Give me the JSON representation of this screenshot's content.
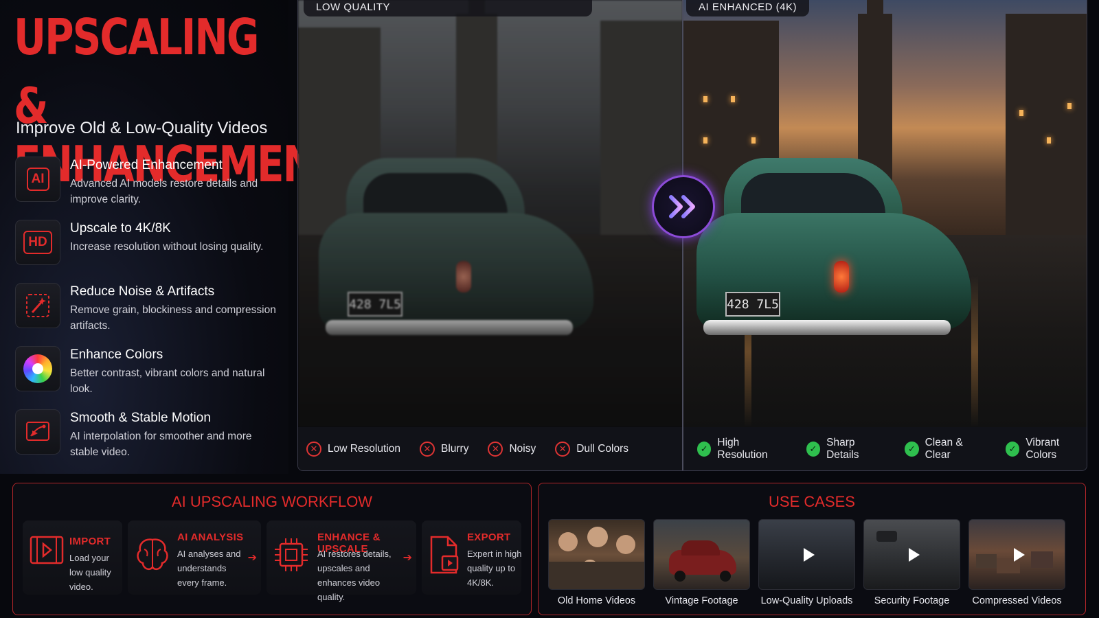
{
  "hero": {
    "title_line1": "UPSCALING &",
    "title_line2": "ENHANCEMENT",
    "subtitle": "Improve Old & Low-Quality Videos"
  },
  "features": [
    {
      "icon": "ai-chip-icon",
      "badge": "AI",
      "title": "AI-Powered Enhancement",
      "desc": "Advanced AI models restore details and improve clarity."
    },
    {
      "icon": "hd-icon",
      "badge": "HD",
      "title": "Upscale to 4K/8K",
      "desc": "Increase resolution without losing quality."
    },
    {
      "icon": "magic-wand-icon",
      "title": "Reduce Noise & Artifacts",
      "desc": "Remove grain, blockiness and compression artifacts."
    },
    {
      "icon": "color-wheel-icon",
      "title": "Enhance Colors",
      "desc": "Better contrast, vibrant colors and natural look."
    },
    {
      "icon": "motion-icon",
      "title": "Smooth & Stable Motion",
      "desc": "AI interpolation for smoother and more stable video."
    }
  ],
  "comparison": {
    "low_label": "LOW QUALITY",
    "high_label": "AI ENHANCED (4K)",
    "plate": "428 7L5",
    "low_chips": [
      "Low Resolution",
      "Blurry",
      "Noisy",
      "Dull Colors"
    ],
    "high_chips": [
      "High Resolution",
      "Sharp Details",
      "Clean & Clear",
      "Vibrant Colors"
    ]
  },
  "workflow": {
    "title": "AI UPSCALING WORKFLOW",
    "steps": [
      {
        "icon": "film-icon",
        "title": "IMPORT",
        "desc": "Load your low quality video."
      },
      {
        "icon": "brain-icon",
        "title": "AI ANALYSIS",
        "desc": "AI analyses and understands every frame."
      },
      {
        "icon": "chip-icon",
        "title": "ENHANCE & UPSCALE",
        "desc": "AI restores details, upscales and enhances video quality."
      },
      {
        "icon": "export-file-icon",
        "title": "EXPORT",
        "desc": "Expert in high quality up to 4K/8K."
      }
    ]
  },
  "usecases": {
    "title": "USE CASES",
    "items": [
      "Old Home Videos",
      "Vintage Footage",
      "Low-Quality Uploads",
      "Security Footage",
      "Compressed Videos"
    ]
  },
  "colors": {
    "accent": "#e32b2b",
    "good": "#2fbf4e",
    "bad": "#e03434",
    "glow": "#8c4bd8"
  }
}
